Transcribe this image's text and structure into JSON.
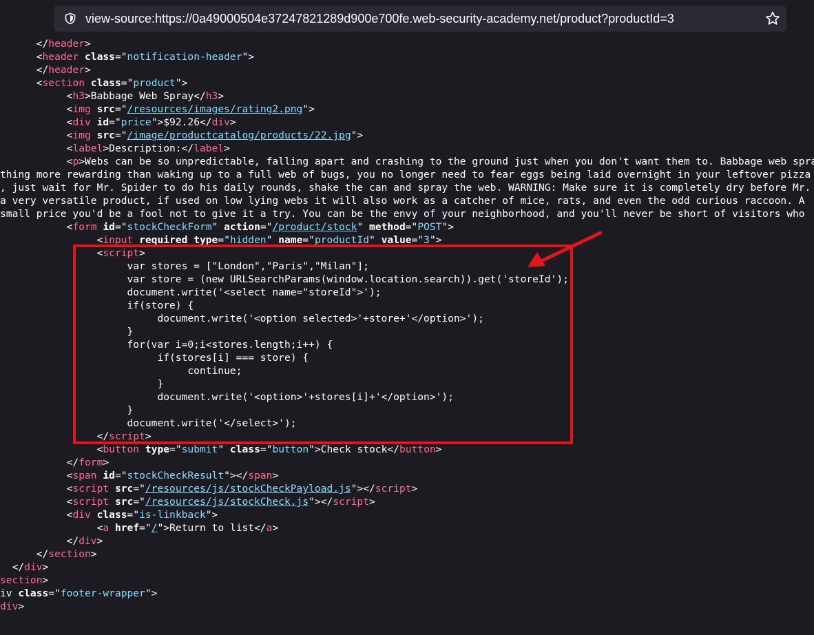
{
  "browser": {
    "url": "view-source:https://0a49000504e37247821289d900e700fe.web-security-academy.net/product?productId=3",
    "icons": [
      "shield-icon",
      "bookmark-star-icon"
    ]
  },
  "annotation": {
    "color": "#e1161d",
    "arrow": "arrow-icon",
    "box": "highlight-box"
  },
  "source_lines": [
    [
      [
        "      </",
        "t"
      ],
      [
        "header",
        "tag"
      ],
      [
        ">",
        "t"
      ]
    ],
    [
      [
        "      <",
        "t"
      ],
      [
        "header",
        "tag"
      ],
      [
        " ",
        "t"
      ],
      [
        "class",
        "attr"
      ],
      [
        "=\"",
        "t"
      ],
      [
        "notification-header",
        "val"
      ],
      [
        "\">",
        "t"
      ]
    ],
    [
      [
        "      </",
        "t"
      ],
      [
        "header",
        "tag"
      ],
      [
        ">",
        "t"
      ]
    ],
    [
      [
        "      <",
        "t"
      ],
      [
        "section",
        "tag"
      ],
      [
        " ",
        "t"
      ],
      [
        "class",
        "attr"
      ],
      [
        "=\"",
        "t"
      ],
      [
        "product",
        "val"
      ],
      [
        "\">",
        "t"
      ]
    ],
    [
      [
        "           <",
        "t"
      ],
      [
        "h3",
        "tag"
      ],
      [
        ">Babbage Web Spray</",
        "t"
      ],
      [
        "h3",
        "tag"
      ],
      [
        ">",
        "t"
      ]
    ],
    [
      [
        "           <",
        "t"
      ],
      [
        "img",
        "tag"
      ],
      [
        " ",
        "t"
      ],
      [
        "src",
        "attr"
      ],
      [
        "=\"",
        "t"
      ],
      [
        "/resources/images/rating2.png",
        "link"
      ],
      [
        "\">",
        "t"
      ]
    ],
    [
      [
        "           <",
        "t"
      ],
      [
        "div",
        "tag"
      ],
      [
        " ",
        "t"
      ],
      [
        "id",
        "attr"
      ],
      [
        "=\"",
        "t"
      ],
      [
        "price",
        "val"
      ],
      [
        "\">$92.26</",
        "t"
      ],
      [
        "div",
        "tag"
      ],
      [
        ">",
        "t"
      ]
    ],
    [
      [
        "           <",
        "t"
      ],
      [
        "img",
        "tag"
      ],
      [
        " ",
        "t"
      ],
      [
        "src",
        "attr"
      ],
      [
        "=\"",
        "t"
      ],
      [
        "/image/productcatalog/products/22.jpg",
        "link"
      ],
      [
        "\">",
        "t"
      ]
    ],
    [
      [
        "           <",
        "t"
      ],
      [
        "label",
        "tag"
      ],
      [
        ">Description:</",
        "t"
      ],
      [
        "label",
        "tag"
      ],
      [
        ">",
        "t"
      ]
    ],
    [
      [
        "           <",
        "t"
      ],
      [
        "p",
        "tag"
      ],
      [
        ">Webs can be so unpredictable, falling apart and crashing to the ground just when you don't want them to. Babbage web spray",
        "t"
      ]
    ],
    [
      [
        "thing more rewarding than waking up to a full web of bugs, you no longer need to fear eggs being laid overnight in your leftover pizza",
        "t"
      ]
    ],
    [
      [
        ", just wait for Mr. Spider to do his daily rounds, shake the can and spray the web. WARNING: Make sure it is completely dry before Mr.",
        "t"
      ]
    ],
    [
      [
        "a very versatile product, if used on low lying webs it will also work as a catcher of mice, rats, and even the odd curious raccoon. A",
        "t"
      ]
    ],
    [
      [
        "small price you'd be a fool not to give it a try. You can be the envy of your neighborhood, and you'll never be short of visitors who",
        "t"
      ]
    ],
    [
      [
        "           <",
        "t"
      ],
      [
        "form",
        "tag"
      ],
      [
        " ",
        "t"
      ],
      [
        "id",
        "attr"
      ],
      [
        "=\"",
        "t"
      ],
      [
        "stockCheckForm",
        "val"
      ],
      [
        "\" ",
        "t"
      ],
      [
        "action",
        "attr"
      ],
      [
        "=\"",
        "t"
      ],
      [
        "/product/stock",
        "link"
      ],
      [
        "\" ",
        "t"
      ],
      [
        "method",
        "attr"
      ],
      [
        "=\"",
        "t"
      ],
      [
        "POST",
        "val"
      ],
      [
        "\">",
        "t"
      ]
    ],
    [
      [
        "                <",
        "t"
      ],
      [
        "input",
        "tag"
      ],
      [
        " ",
        "t"
      ],
      [
        "required",
        "attr"
      ],
      [
        " ",
        "t"
      ],
      [
        "type",
        "attr"
      ],
      [
        "=\"",
        "t"
      ],
      [
        "hidden",
        "val"
      ],
      [
        "\" ",
        "t"
      ],
      [
        "name",
        "attr"
      ],
      [
        "=\"",
        "t"
      ],
      [
        "productId",
        "val"
      ],
      [
        "\" ",
        "t"
      ],
      [
        "value",
        "attr"
      ],
      [
        "=\"",
        "t"
      ],
      [
        "3",
        "val"
      ],
      [
        "\">",
        "t"
      ]
    ],
    [
      [
        "                <",
        "t"
      ],
      [
        "script",
        "tag"
      ],
      [
        ">",
        "t"
      ]
    ],
    [
      [
        "                     var stores = [\"London\",\"Paris\",\"Milan\"];",
        "t"
      ]
    ],
    [
      [
        "                     var store = (new URLSearchParams(window.location.search)).get('storeId');",
        "t"
      ]
    ],
    [
      [
        "                     document.write('<select name=\"storeId\">');",
        "t"
      ]
    ],
    [
      [
        "                     if(store) {",
        "t"
      ]
    ],
    [
      [
        "                          document.write('<option selected>'+store+'</option>');",
        "t"
      ]
    ],
    [
      [
        "                     }",
        "t"
      ]
    ],
    [
      [
        "                     for(var i=0;i<stores.length;i++) {",
        "t"
      ]
    ],
    [
      [
        "                          if(stores[i] === store) {",
        "t"
      ]
    ],
    [
      [
        "                               continue;",
        "t"
      ]
    ],
    [
      [
        "                          }",
        "t"
      ]
    ],
    [
      [
        "                          document.write('<option>'+stores[i]+'</option>');",
        "t"
      ]
    ],
    [
      [
        "                     }",
        "t"
      ]
    ],
    [
      [
        "                     document.write('</select>');",
        "t"
      ]
    ],
    [
      [
        "                </",
        "t"
      ],
      [
        "script",
        "tag"
      ],
      [
        ">",
        "t"
      ]
    ],
    [
      [
        "                <",
        "t"
      ],
      [
        "button",
        "tag"
      ],
      [
        " ",
        "t"
      ],
      [
        "type",
        "attr"
      ],
      [
        "=\"",
        "t"
      ],
      [
        "submit",
        "val"
      ],
      [
        "\" ",
        "t"
      ],
      [
        "class",
        "attr"
      ],
      [
        "=\"",
        "t"
      ],
      [
        "button",
        "val"
      ],
      [
        "\">Check stock</",
        "t"
      ],
      [
        "button",
        "tag"
      ],
      [
        ">",
        "t"
      ]
    ],
    [
      [
        "           </",
        "t"
      ],
      [
        "form",
        "tag"
      ],
      [
        ">",
        "t"
      ]
    ],
    [
      [
        "           <",
        "t"
      ],
      [
        "span",
        "tag"
      ],
      [
        " ",
        "t"
      ],
      [
        "id",
        "attr"
      ],
      [
        "=\"",
        "t"
      ],
      [
        "stockCheckResult",
        "val"
      ],
      [
        "\"></",
        "t"
      ],
      [
        "span",
        "tag"
      ],
      [
        ">",
        "t"
      ]
    ],
    [
      [
        "           <",
        "t"
      ],
      [
        "script",
        "tag"
      ],
      [
        " ",
        "t"
      ],
      [
        "src",
        "attr"
      ],
      [
        "=\"",
        "t"
      ],
      [
        "/resources/js/stockCheckPayload.js",
        "link"
      ],
      [
        "\"></",
        "t"
      ],
      [
        "script",
        "tag"
      ],
      [
        ">",
        "t"
      ]
    ],
    [
      [
        "           <",
        "t"
      ],
      [
        "script",
        "tag"
      ],
      [
        " ",
        "t"
      ],
      [
        "src",
        "attr"
      ],
      [
        "=\"",
        "t"
      ],
      [
        "/resources/js/stockCheck.js",
        "link"
      ],
      [
        "\"></",
        "t"
      ],
      [
        "script",
        "tag"
      ],
      [
        ">",
        "t"
      ]
    ],
    [
      [
        "           <",
        "t"
      ],
      [
        "div",
        "tag"
      ],
      [
        " ",
        "t"
      ],
      [
        "class",
        "attr"
      ],
      [
        "=\"",
        "t"
      ],
      [
        "is-linkback",
        "val"
      ],
      [
        "\">",
        "t"
      ]
    ],
    [
      [
        "                <",
        "t"
      ],
      [
        "a",
        "tag"
      ],
      [
        " ",
        "t"
      ],
      [
        "href",
        "attr"
      ],
      [
        "=\"",
        "t"
      ],
      [
        "/",
        "link"
      ],
      [
        "\">Return to list</",
        "t"
      ],
      [
        "a",
        "tag"
      ],
      [
        ">",
        "t"
      ]
    ],
    [
      [
        "           </",
        "t"
      ],
      [
        "div",
        "tag"
      ],
      [
        ">",
        "t"
      ]
    ],
    [
      [
        "      </",
        "t"
      ],
      [
        "section",
        "tag"
      ],
      [
        ">",
        "t"
      ]
    ],
    [
      [
        "  </",
        "t"
      ],
      [
        "div",
        "tag"
      ],
      [
        ">",
        "t"
      ]
    ],
    [
      [
        "section",
        "tag"
      ],
      [
        ">",
        "t"
      ]
    ],
    [
      [
        "iv ",
        "t"
      ],
      [
        "class",
        "attr"
      ],
      [
        "=\"",
        "t"
      ],
      [
        "footer-wrapper",
        "val"
      ],
      [
        "\">",
        "t"
      ]
    ],
    [
      [
        "div",
        "tag"
      ],
      [
        ">",
        "t"
      ]
    ]
  ]
}
